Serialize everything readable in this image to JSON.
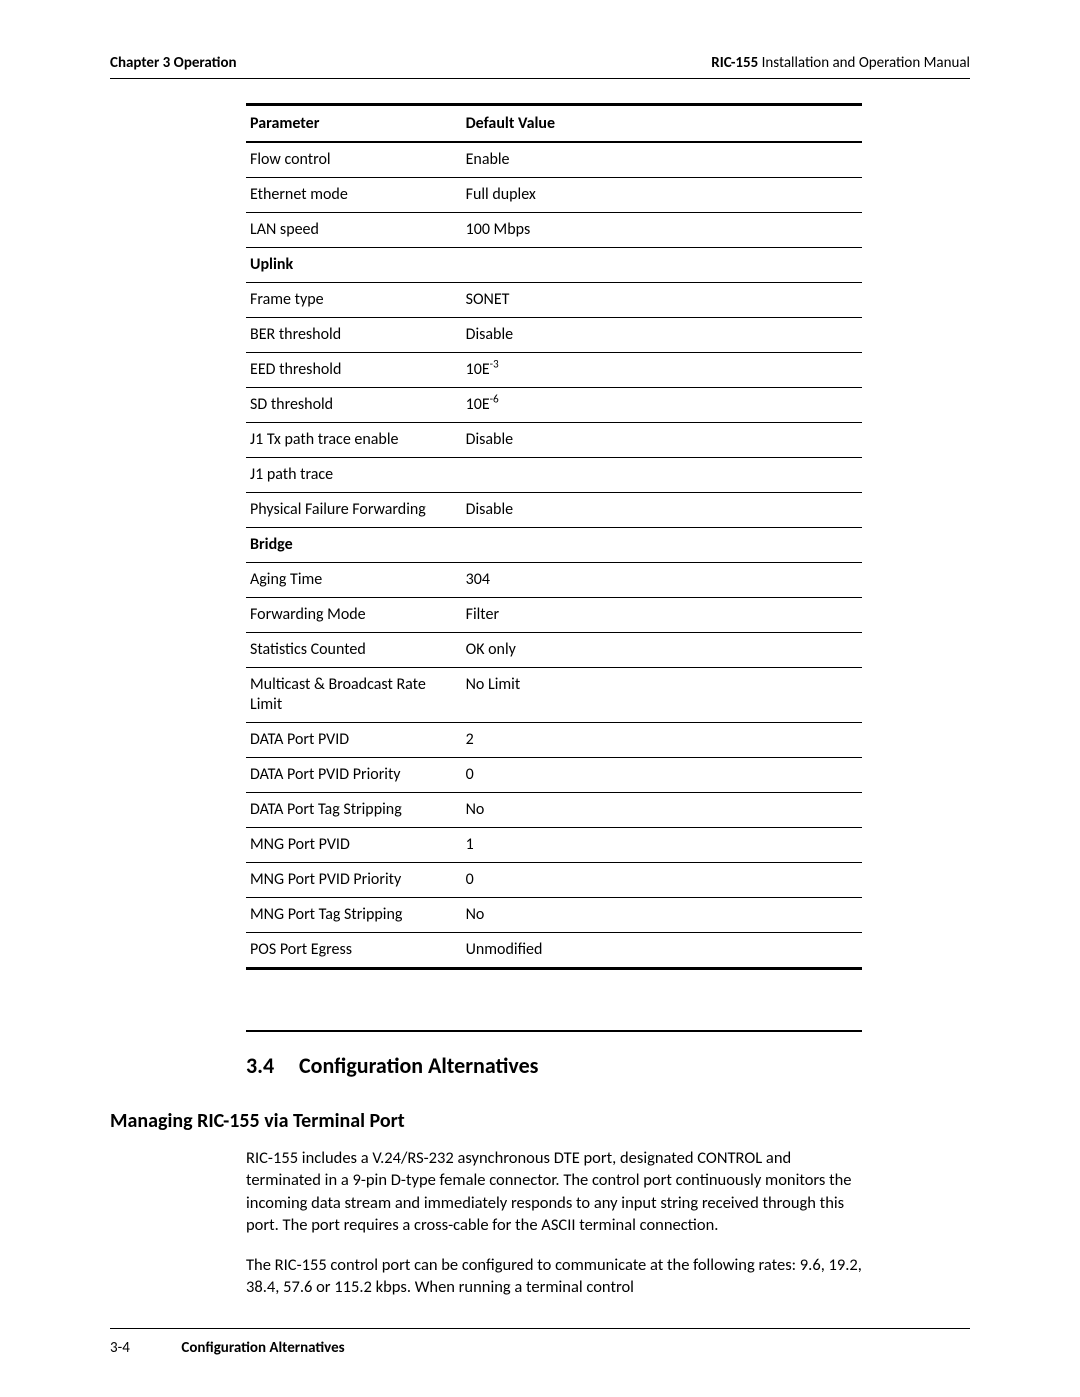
{
  "header": {
    "left": "Chapter 3  Operation",
    "right_bold": "RIC-155",
    "right_rest": " Installation and Operation Manual"
  },
  "table": {
    "head": {
      "c1": "Parameter",
      "c2": "Default Value"
    },
    "rows": [
      {
        "type": "row",
        "param": "Flow control",
        "value": "Enable"
      },
      {
        "type": "row",
        "param": "Ethernet mode",
        "value": "Full duplex"
      },
      {
        "type": "row",
        "param": "LAN speed",
        "value": "100 Mbps"
      },
      {
        "type": "section",
        "param": "Uplink"
      },
      {
        "type": "row",
        "param": "Frame type",
        "value": "SONET"
      },
      {
        "type": "row",
        "param": "BER threshold",
        "value": "Disable"
      },
      {
        "type": "row",
        "param": "EED threshold",
        "value_html": "10E<sup>-3</sup>",
        "value": "10E-3"
      },
      {
        "type": "row",
        "param": "SD threshold",
        "value_html": "10E<sup>-6</sup>",
        "value": "10E-6"
      },
      {
        "type": "row",
        "param": "J1 Tx path trace enable",
        "value": "Disable"
      },
      {
        "type": "row",
        "param": "J1 path trace",
        "value": ""
      },
      {
        "type": "row",
        "param": "Physical Failure Forwarding",
        "value": "Disable"
      },
      {
        "type": "section",
        "param": "Bridge"
      },
      {
        "type": "row",
        "param": "Aging Time",
        "value": "304"
      },
      {
        "type": "row",
        "param": "Forwarding Mode",
        "value": "Filter"
      },
      {
        "type": "row",
        "param": "Statistics Counted",
        "value": "OK only"
      },
      {
        "type": "row",
        "param": "Multicast & Broadcast Rate Limit",
        "value": "No Limit"
      },
      {
        "type": "row",
        "param": "DATA Port PVID",
        "value": "2"
      },
      {
        "type": "row",
        "param": "DATA Port PVID Priority",
        "value": "0"
      },
      {
        "type": "row",
        "param": "DATA Port Tag Stripping",
        "value": "No"
      },
      {
        "type": "row",
        "param": "MNG Port PVID",
        "value": "1"
      },
      {
        "type": "row",
        "param": "MNG Port PVID Priority",
        "value": "0"
      },
      {
        "type": "row",
        "param": "MNG Port Tag Stripping",
        "value": "No"
      },
      {
        "type": "row",
        "param": "POS Port Egress",
        "value": "Unmodified"
      }
    ]
  },
  "section": {
    "number": "3.4",
    "title": "Configuration Alternatives"
  },
  "subsection": {
    "title": "Managing RIC-155 via Terminal Port"
  },
  "paragraphs": {
    "p1": "RIC-155 includes a V.24/RS-232 asynchronous DTE port, designated CONTROL and terminated in a 9-pin D-type female connector. The control port continuously monitors the incoming data stream and immediately responds to any input string received through this port. The port requires a cross-cable for the ASCII terminal connection.",
    "p2": "The RIC-155 control port can be configured to communicate at the following rates: 9.6, 19.2, 38.4, 57.6 or 115.2 kbps. When running a terminal control"
  },
  "footer": {
    "page": "3-4",
    "title": "Configuration Alternatives"
  }
}
